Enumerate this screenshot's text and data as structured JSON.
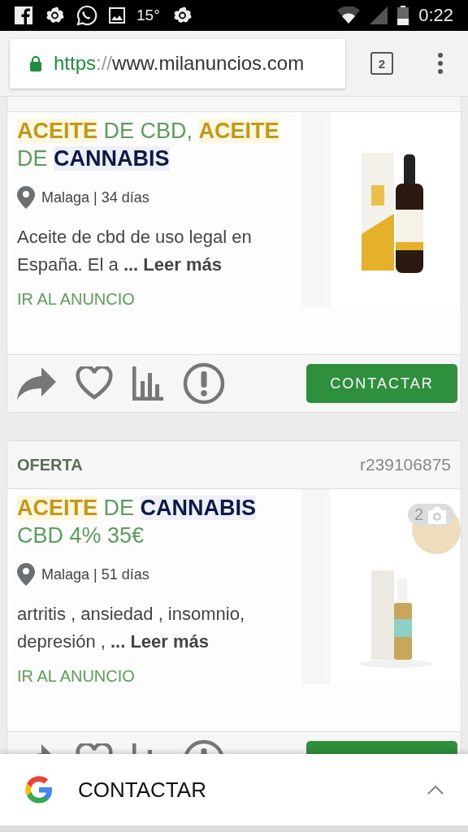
{
  "status_bar": {
    "temperature": "15°",
    "time": "0:22"
  },
  "browser": {
    "url_scheme": "https",
    "url_separator": "://",
    "url_host": "www.milanuncios.com",
    "tab_count": "2"
  },
  "listings": [
    {
      "title_lines": [
        [
          {
            "kind": "keyword",
            "text": "ACEITE"
          },
          {
            "kind": "plain",
            "text": " DE CBD, "
          },
          {
            "kind": "keyword",
            "text": "ACEITE"
          }
        ],
        [
          {
            "kind": "plain",
            "text": "DE "
          },
          {
            "kind": "brand",
            "text": "CANNABIS"
          }
        ]
      ],
      "location": "Malaga | 34 días",
      "description": "Aceite de cbd de uso legal en España. El a **... Leer más**",
      "link": "IR AL ANUNCIO",
      "contact_button": "CONTACTAR"
    },
    {
      "header_label": "OFERTA",
      "reference": "r239106875",
      "title_lines": [
        [
          {
            "kind": "keyword",
            "text": "ACEITE"
          },
          {
            "kind": "plain",
            "text": " DE "
          },
          {
            "kind": "brand",
            "text": "CANNABIS"
          }
        ],
        [
          {
            "kind": "plain",
            "text": "CBD 4% 35€"
          }
        ]
      ],
      "photo_count": "2",
      "location": "Malaga | 51 días",
      "description": "artritis , ansiedad , insomnio, depresión , **... Leer más**",
      "link": "IR AL ANUNCIO"
    }
  ],
  "bottom_sheet": {
    "label": "CONTACTAR"
  }
}
